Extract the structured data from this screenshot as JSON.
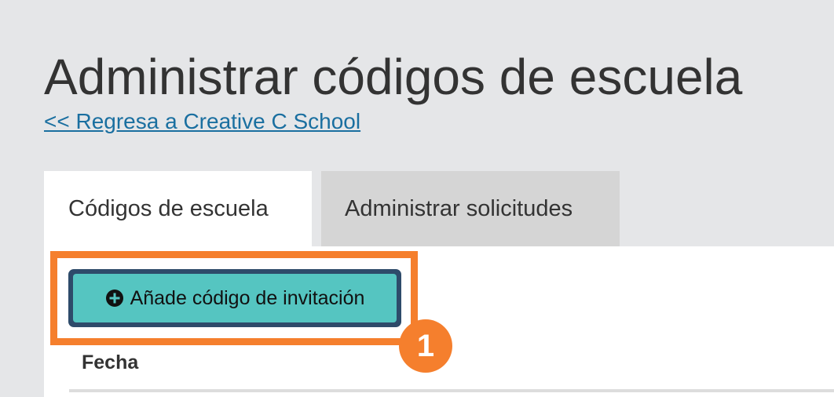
{
  "page": {
    "title": "Administrar códigos de escuela",
    "back_link": "<< Regresa a Creative C School"
  },
  "tabs": [
    {
      "label": "Códigos de escuela",
      "active": true
    },
    {
      "label": "Administrar solicitudes",
      "active": false
    }
  ],
  "toolbar": {
    "add_invite_label": "Añade código de invitación",
    "add_invite_icon": "plus-circle-icon"
  },
  "annotation": {
    "step_number": "1",
    "highlight_color": "#f57f2d"
  },
  "table": {
    "columns": [
      "Fecha"
    ]
  },
  "colors": {
    "button_background": "#55c5c1",
    "button_border": "#2e4b6a",
    "link": "#1a6fa0"
  }
}
